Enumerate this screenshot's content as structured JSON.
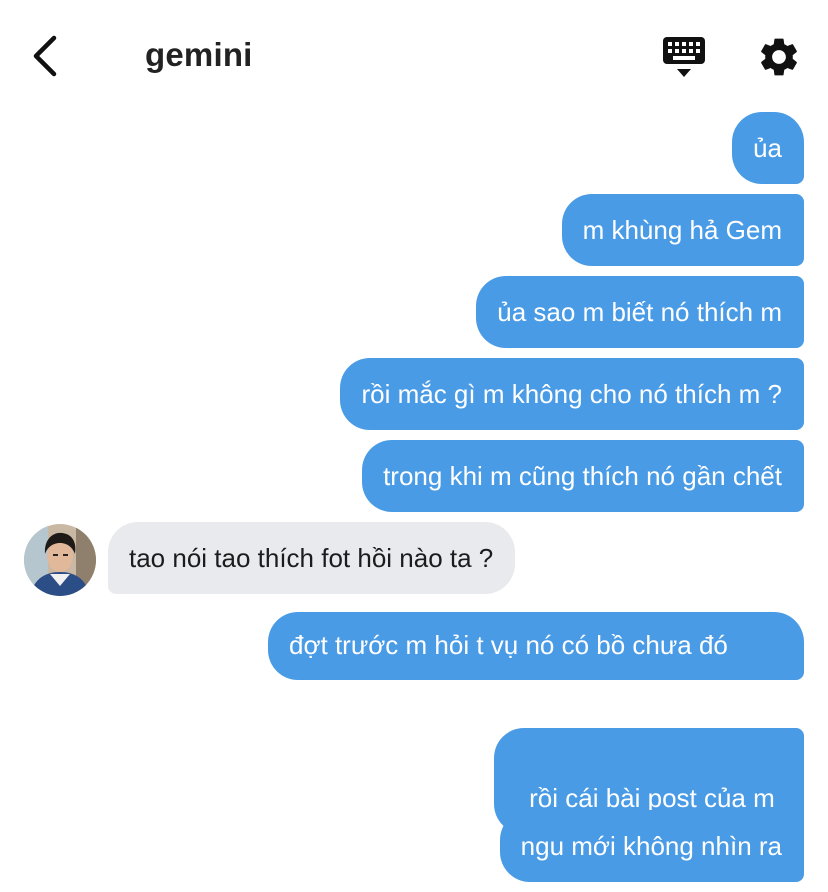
{
  "header": {
    "title": "gemini",
    "back_icon": "chevron-left-icon",
    "keyboard_icon": "keyboard-icon",
    "settings_icon": "gear-icon"
  },
  "colors": {
    "outgoing_bubble": "#4a9be6",
    "incoming_bubble": "#e9eaed",
    "outgoing_text": "#ffffff",
    "incoming_text": "#1c1c1e",
    "icons": "#111111"
  },
  "messages": [
    {
      "sender": "me",
      "text": "ủa"
    },
    {
      "sender": "me",
      "text": "m khùng hả Gem"
    },
    {
      "sender": "me",
      "text": "ủa sao m biết nó thích m"
    },
    {
      "sender": "me",
      "text": "rồi mắc gì m không cho nó thích m ?"
    },
    {
      "sender": "me",
      "text": "trong khi m cũng thích nó gần chết"
    },
    {
      "sender": "other",
      "text": "tao nói tao thích fot hồi nào ta ?"
    },
    {
      "sender": "me",
      "text": "đợt trước m hỏi t vụ nó có bồ chưa đó"
    },
    {
      "sender": "me",
      "text": "rồi cái bài post của m "
    },
    {
      "sender": "me",
      "text": "ngu mới không nhìn ra"
    }
  ]
}
